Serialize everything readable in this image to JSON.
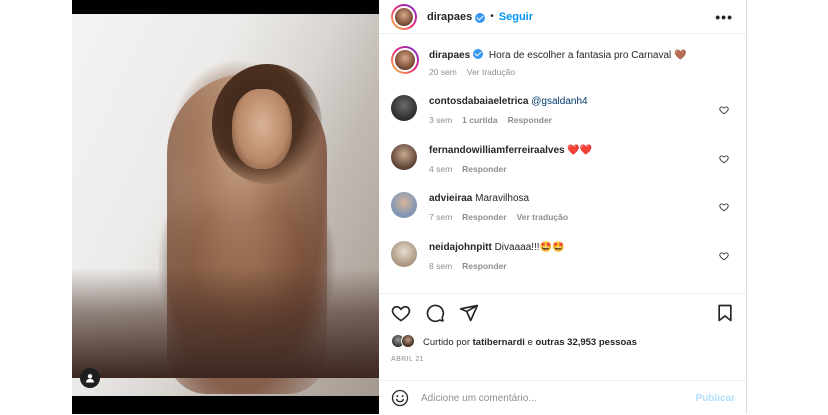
{
  "header": {
    "username": "dirapaes",
    "follow_label": "Seguir",
    "more_label": "•••"
  },
  "caption": {
    "username": "dirapaes",
    "text": "Hora de escolher a fantasia pro Carnaval",
    "emoji": "🤎",
    "time": "20 sem",
    "translate": "Ver tradução"
  },
  "comments": [
    {
      "username": "contosdabaiaeletrica",
      "text": "@gsaldanh4",
      "time": "3 sem",
      "likes": "1 curtida",
      "reply": "Responder",
      "translate": ""
    },
    {
      "username": "fernandowilliamferreiraalves",
      "text": "❤️❤️",
      "time": "4 sem",
      "likes": "",
      "reply": "Responder",
      "translate": ""
    },
    {
      "username": "advieiraa",
      "text": "Maravilhosa",
      "time": "7 sem",
      "likes": "",
      "reply": "Responder",
      "translate": "Ver tradução"
    },
    {
      "username": "neidajohnpitt",
      "text": "Divaaaa!!!🤩🤩",
      "time": "8 sem",
      "likes": "",
      "reply": "Responder",
      "translate": ""
    }
  ],
  "likes": {
    "prefix": "Curtido por",
    "user": "tatibernardi",
    "joiner": "e",
    "others": "outras 32,953 pessoas"
  },
  "date": "ABRIL 21",
  "add_comment": {
    "placeholder": "Adicione um comentário...",
    "publish_label": "Publicar"
  },
  "colors": {
    "accent": "#0095f6",
    "verified": "#3897f0",
    "muted": "#8e8e8e",
    "publish_disabled": "#b2dffc"
  }
}
